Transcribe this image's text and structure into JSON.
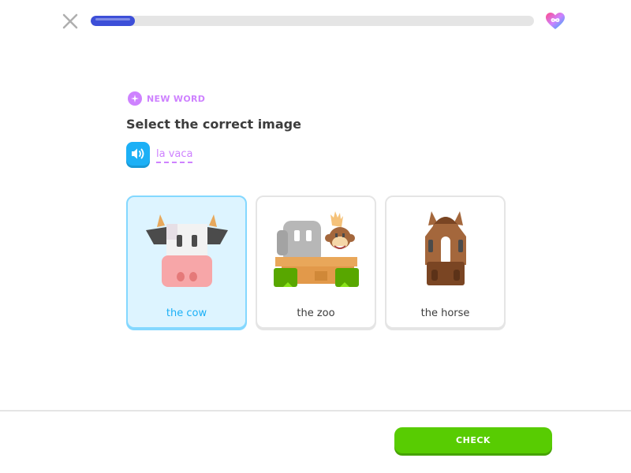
{
  "header": {
    "close_icon": "close-icon",
    "progress": 0.1,
    "hearts_icon": "infinite-hearts-icon",
    "colors": {
      "progress_fill": "#3d4fd8",
      "progress_track": "#e5e5e5"
    }
  },
  "badge": {
    "label": "NEW WORD",
    "icon": "sparkle-icon",
    "color": "#ce82ff"
  },
  "prompt": {
    "title": "Select the correct image",
    "speaker_icon": "speaker-icon",
    "word": "la vaca",
    "word_color": "#ce82ff",
    "speaker_color": "#1cb0f6"
  },
  "choices": [
    {
      "label": "the cow",
      "image": "cow-illustration",
      "selected": true
    },
    {
      "label": "the zoo",
      "image": "zoo-illustration",
      "selected": false
    },
    {
      "label": "the horse",
      "image": "horse-illustration",
      "selected": false
    }
  ],
  "footer": {
    "check_label": "CHECK",
    "check_color": "#58cc02"
  }
}
